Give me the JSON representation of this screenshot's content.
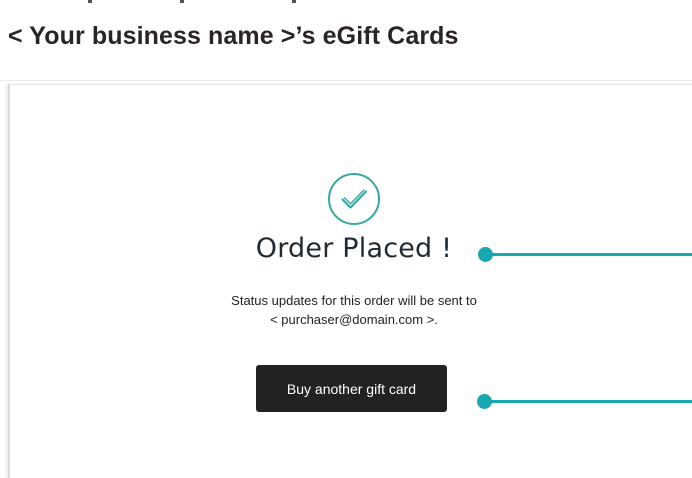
{
  "header": {
    "title": "< Your business name >’s eGift Cards"
  },
  "confirmation": {
    "icon": "check-circle-icon",
    "title": "Order Placed !",
    "status_line_1": "Status updates for this order will be sent to",
    "status_line_2": "< purchaser@domain.com >."
  },
  "actions": {
    "buy_another_label": "Buy another gift card"
  },
  "colors": {
    "accent": "#17a8b0",
    "check_icon": "#3aa89f",
    "button_bg": "#222222",
    "title_text": "#2b2424"
  }
}
